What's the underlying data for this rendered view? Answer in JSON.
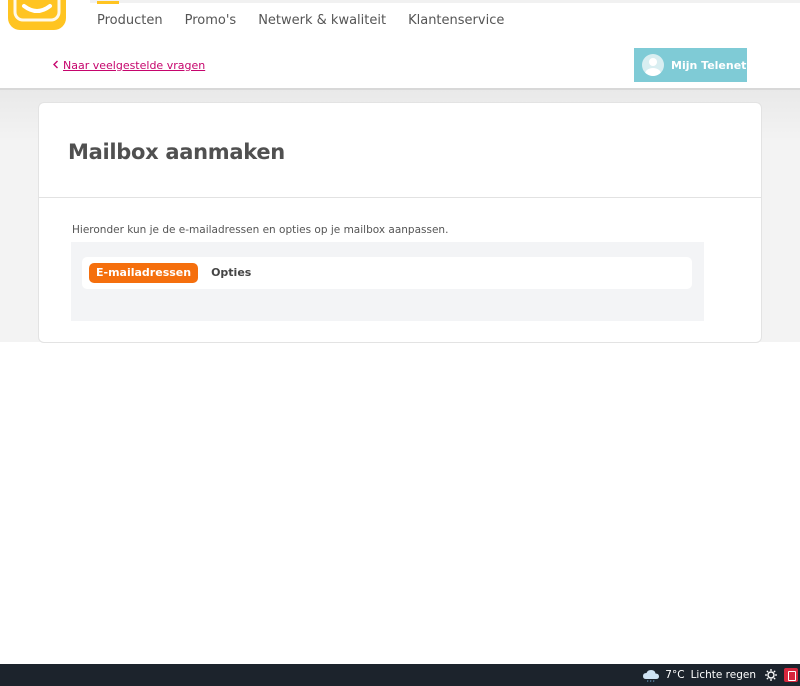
{
  "header": {
    "nav": [
      "Producten",
      "Promo's",
      "Netwerk & kwaliteit",
      "Klantenservice"
    ],
    "back_link": "Naar veelgestelde vragen",
    "account_button": "Mijn Telenet"
  },
  "main": {
    "title": "Mailbox aanmaken",
    "intro": "Hieronder kun je de e-mailadressen en opties op je mailbox aanpassen.",
    "tabs": [
      {
        "label": "E-mailadressen",
        "active": true
      },
      {
        "label": "Opties",
        "active": false
      }
    ]
  },
  "taskbar": {
    "temperature": "7°C",
    "condition": "Lichte regen"
  },
  "colors": {
    "brand_yellow": "#ffc421",
    "link_magenta": "#c6056d",
    "accent_orange": "#f56f0d",
    "account_teal": "#7fcbd6"
  }
}
